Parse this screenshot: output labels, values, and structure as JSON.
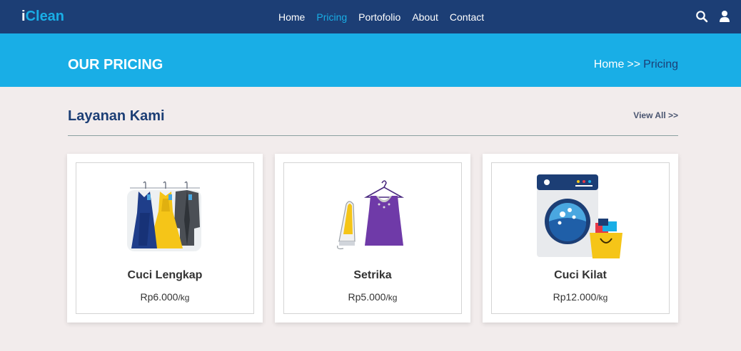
{
  "navbar": {
    "brand_i": "i",
    "brand_rest": "Clean",
    "links": [
      "Home",
      "Pricing",
      "Portofolio",
      "About",
      "Contact"
    ],
    "active_link": "Pricing",
    "icons": [
      "search-icon",
      "user-icon"
    ]
  },
  "banner": {
    "title": "OUR PRICING",
    "breadcrumb_home": "Home",
    "breadcrumb_sep": ">>",
    "breadcrumb_current": "Pricing"
  },
  "section": {
    "title": "Layanan Kami",
    "view_all": "View All >>"
  },
  "cards": [
    {
      "name": "Cuci Lengkap",
      "price": "Rp6.000",
      "unit": "/kg",
      "icon": "dresses-on-hangers-icon"
    },
    {
      "name": "Setrika",
      "price": "Rp5.000",
      "unit": "/kg",
      "icon": "iron-and-dress-icon"
    },
    {
      "name": "Cuci Kilat",
      "price": "Rp12.000",
      "unit": "/kg",
      "icon": "washing-machine-icon"
    }
  ],
  "colors": {
    "navy": "#1c3e75",
    "accent": "#19aee6",
    "page_bg": "#f2ecec"
  }
}
